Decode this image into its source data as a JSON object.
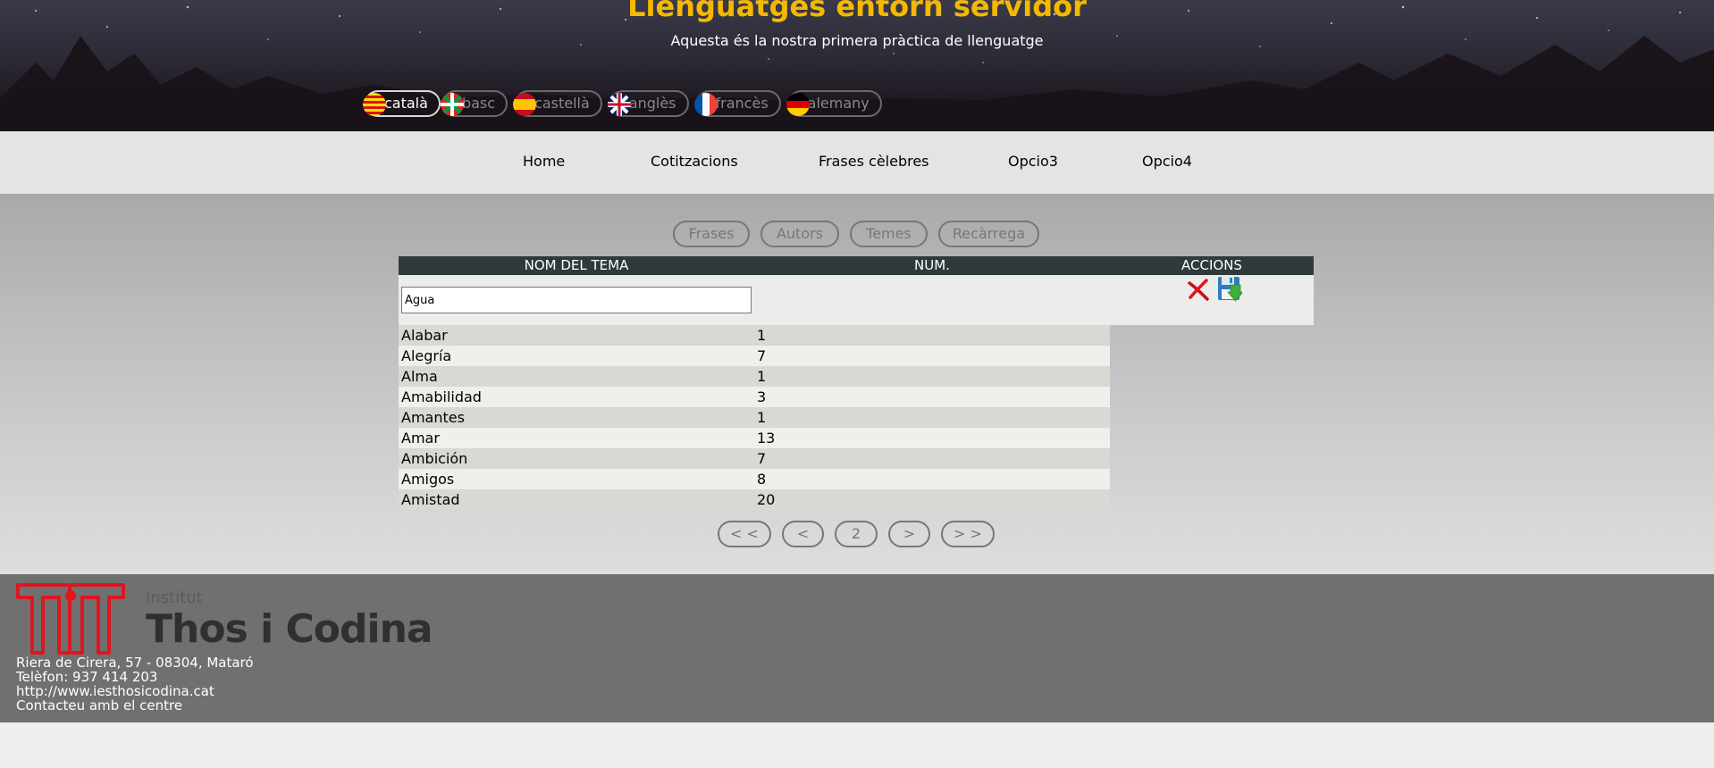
{
  "header": {
    "title": "Llenguatges entorn servidor",
    "subtitle": "Aquesta és la nostra primera pràctica de llenguatge",
    "languages": [
      {
        "label": "català",
        "active": true
      },
      {
        "label": "basc",
        "active": false
      },
      {
        "label": "castellà",
        "active": false
      },
      {
        "label": "anglès",
        "active": false
      },
      {
        "label": "francès",
        "active": false
      },
      {
        "label": "alemany",
        "active": false
      }
    ]
  },
  "nav": {
    "items": [
      "Home",
      "Cotitzacions",
      "Frases cèlebres",
      "Opcio3",
      "Opcio4"
    ]
  },
  "tabs": [
    "Frases",
    "Autors",
    "Temes",
    "Recàrrega"
  ],
  "table": {
    "headers": [
      "NOM DEL TEMA",
      "NUM.",
      "ACCIONS"
    ],
    "edit_value": "Agua",
    "rows": [
      {
        "name": "Alabar",
        "num": "1"
      },
      {
        "name": "Alegría",
        "num": "7"
      },
      {
        "name": "Alma",
        "num": "1"
      },
      {
        "name": "Amabilidad",
        "num": "3"
      },
      {
        "name": "Amantes",
        "num": "1"
      },
      {
        "name": "Amar",
        "num": "13"
      },
      {
        "name": "Ambición",
        "num": "7"
      },
      {
        "name": "Amigos",
        "num": "8"
      },
      {
        "name": "Amistad",
        "num": "20"
      }
    ]
  },
  "pagination": {
    "first": "< <",
    "prev": "<",
    "current": "2",
    "next": ">",
    "last": "> >"
  },
  "footer": {
    "logo_small": "Institut",
    "logo_name": "Thos i Codina",
    "address": "Riera de Cirera, 57 - 08304, Mataró",
    "phone": "Telèfon: 937 414 203",
    "website": "http://www.iesthosicodina.cat",
    "contact": "Contacteu amb el centre"
  },
  "icons": {
    "delete": "delete-x-icon",
    "save": "save-floppy-icon"
  },
  "colors": {
    "title": "#f5b800",
    "table_header": "#2f3a3a",
    "footer": "#707070",
    "logo_red": "#e0151e"
  }
}
